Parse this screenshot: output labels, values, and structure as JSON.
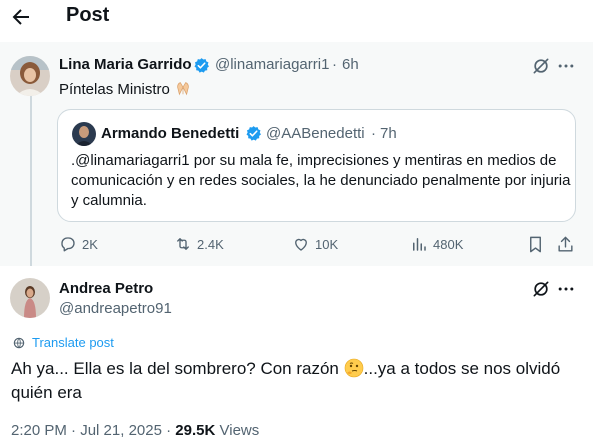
{
  "header": {
    "title": "Post"
  },
  "reply": {
    "author_name": "Lina Maria Garrido",
    "handle": "@linamariagarri1",
    "time_sep": "·",
    "time": "6h",
    "text": "Píntelas Ministro",
    "quote": {
      "author_name": "Armando Benedetti",
      "handle": "@AABenedetti",
      "time_sep": "·",
      "time": "7h",
      "text": ".@linamariagarri1 por su mala fe, imprecisiones y mentiras en medios de comunicación y en redes sociales, la he denunciado penalmente por injuria y calumnia."
    },
    "actions": {
      "replies": "2K",
      "reposts": "2.4K",
      "likes": "10K",
      "views": "480K"
    }
  },
  "main_post": {
    "author_name": "Andrea Petro",
    "handle": "@andreapetro91",
    "translate_label": "Translate post",
    "text_before_emoji": "Ah ya... Ella es la del sombrero? Con razón ",
    "text_after_emoji": "...ya a todos se nos olvidó quién era",
    "time": "2:20 PM",
    "date_sep": "·",
    "date": "Jul 21, 2025",
    "views_sep": "·",
    "views_count": "29.5K",
    "views_label": "Views"
  },
  "colors": {
    "accent": "#1d9bf0",
    "muted": "#536471",
    "text": "#0f1419",
    "border": "#cfd9de",
    "panel": "#f7f9f9"
  },
  "icons": {
    "back": "arrow-left-icon",
    "verified": "verified-badge-icon",
    "grok": "grok-icon",
    "more": "more-dots-icon",
    "reply": "reply-icon",
    "repost": "repost-icon",
    "like": "heart-icon",
    "views": "views-icon",
    "bookmark": "bookmark-icon",
    "share": "share-icon",
    "translate": "globe-icon",
    "hands_emoji": "folded-hands-emoji",
    "thinking_emoji": "thinking-face-emoji"
  }
}
